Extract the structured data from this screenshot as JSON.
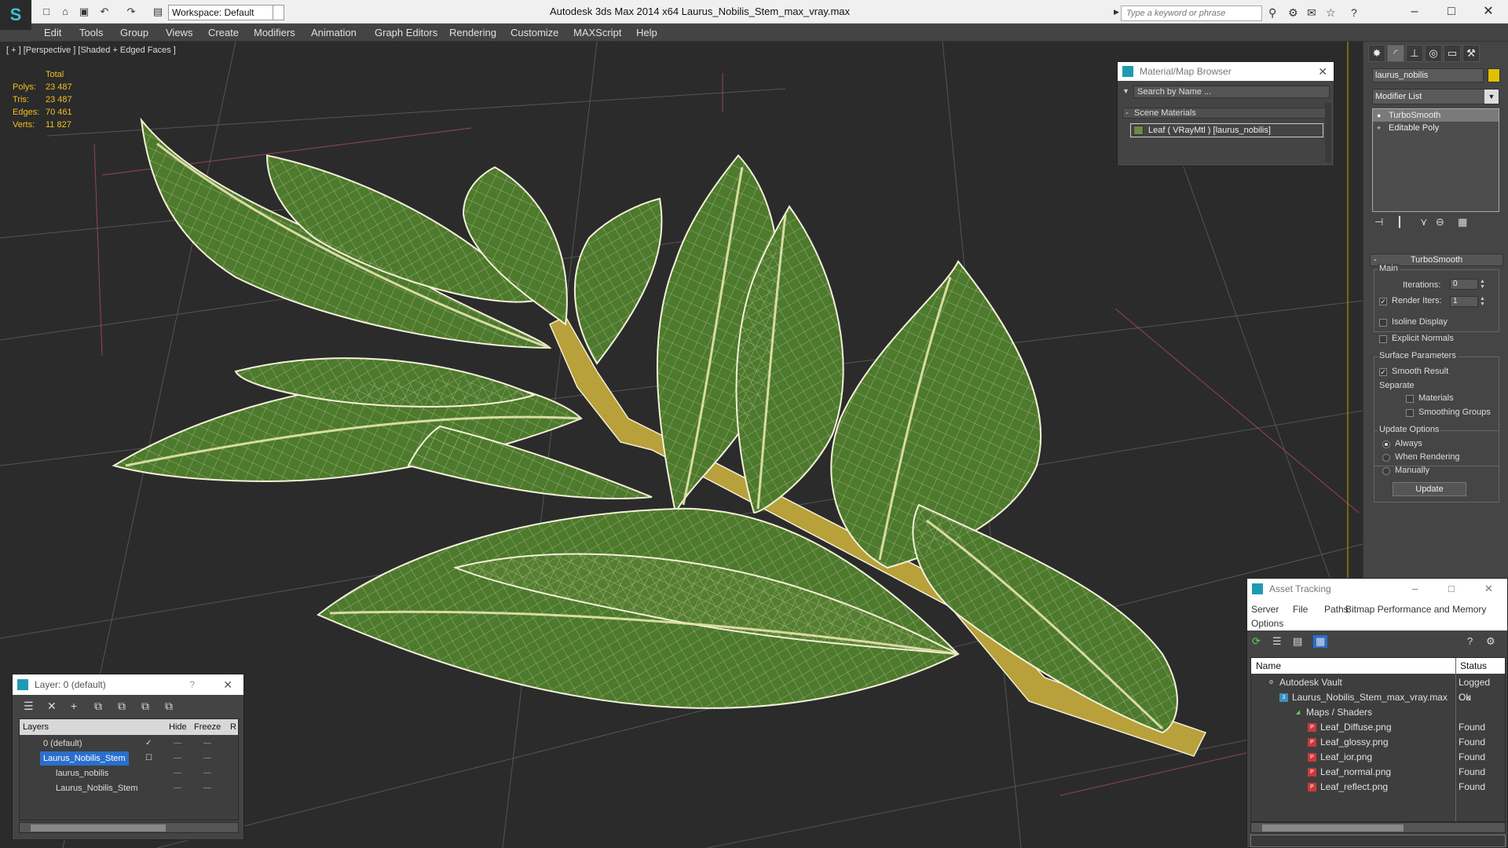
{
  "titlebar": {
    "title": "Autodesk 3ds Max  2014 x64      Laurus_Nobilis_Stem_max_vray.max",
    "workspace": "Workspace: Default",
    "search_placeholder": "Type a keyword or phrase"
  },
  "menu": [
    "Edit",
    "Tools",
    "Group",
    "Views",
    "Create",
    "Modifiers",
    "Animation",
    "Graph Editors",
    "Rendering",
    "Customize",
    "MAXScript",
    "Help"
  ],
  "viewport": {
    "label": "[ + ] [Perspective ] [Shaded + Edged Faces ]",
    "stats_header": "Total",
    "stats": [
      {
        "label": "Polys:",
        "value": "23 487"
      },
      {
        "label": "Tris:",
        "value": "23 487"
      },
      {
        "label": "Edges:",
        "value": "70 461"
      },
      {
        "label": "Verts:",
        "value": "11 827"
      }
    ]
  },
  "command_panel": {
    "object_name": "laurus_nobilis",
    "modifier_list": "Modifier List",
    "stack": [
      "TurboSmooth",
      "Editable Poly"
    ],
    "rollout_title": "TurboSmooth",
    "main_group": "Main",
    "iterations_label": "Iterations:",
    "iterations_value": "0",
    "render_iters_label": "Render Iters:",
    "render_iters_value": "1",
    "isoline_label": "Isoline Display",
    "explicit_normals_label": "Explicit Normals",
    "surface_params_label": "Surface Parameters",
    "smooth_result_label": "Smooth Result",
    "separate_label": "Separate",
    "materials_label": "Materials",
    "smoothing_groups_label": "Smoothing Groups",
    "update_options_label": "Update Options",
    "always_label": "Always",
    "when_rendering_label": "When Rendering",
    "manually_label": "Manually",
    "update_button": "Update"
  },
  "material_browser": {
    "title": "Material/Map Browser",
    "search_placeholder": "Search by Name ...",
    "section": "Scene Materials",
    "item": "Leaf  ( VRayMtl ) [laurus_nobilis]"
  },
  "layer_window": {
    "title": "Layer: 0 (default)",
    "help": "?",
    "columns": [
      "Layers",
      "Hide",
      "Freeze",
      "R"
    ],
    "rows": [
      {
        "name": "0 (default)"
      },
      {
        "name": "Laurus_Nobilis_Stem"
      },
      {
        "name": "laurus_nobilis"
      },
      {
        "name": "Laurus_Nobilis_Stem"
      }
    ]
  },
  "asset_tracking": {
    "title": "Asset Tracking",
    "menu": [
      "Server",
      "File",
      "Paths",
      "Bitmap Performance and Memory",
      "Options"
    ],
    "columns": [
      "Name",
      "Status"
    ],
    "rows": [
      {
        "name": "Autodesk Vault",
        "status": "Logged Ou"
      },
      {
        "name": "Laurus_Nobilis_Stem_max_vray.max",
        "status": "Ok"
      },
      {
        "name": "Maps / Shaders",
        "status": ""
      },
      {
        "name": "Leaf_Diffuse.png",
        "status": "Found"
      },
      {
        "name": "Leaf_glossy.png",
        "status": "Found"
      },
      {
        "name": "Leaf_ior.png",
        "status": "Found"
      },
      {
        "name": "Leaf_normal.png",
        "status": "Found"
      },
      {
        "name": "Leaf_reflect.png",
        "status": "Found"
      }
    ]
  },
  "colors": {
    "leaf_fill": "#4d7a2c",
    "wire": "#f4f0d8",
    "stem": "#b8a03a",
    "stats": "#f0c020",
    "selection": "#2a6fcc"
  }
}
